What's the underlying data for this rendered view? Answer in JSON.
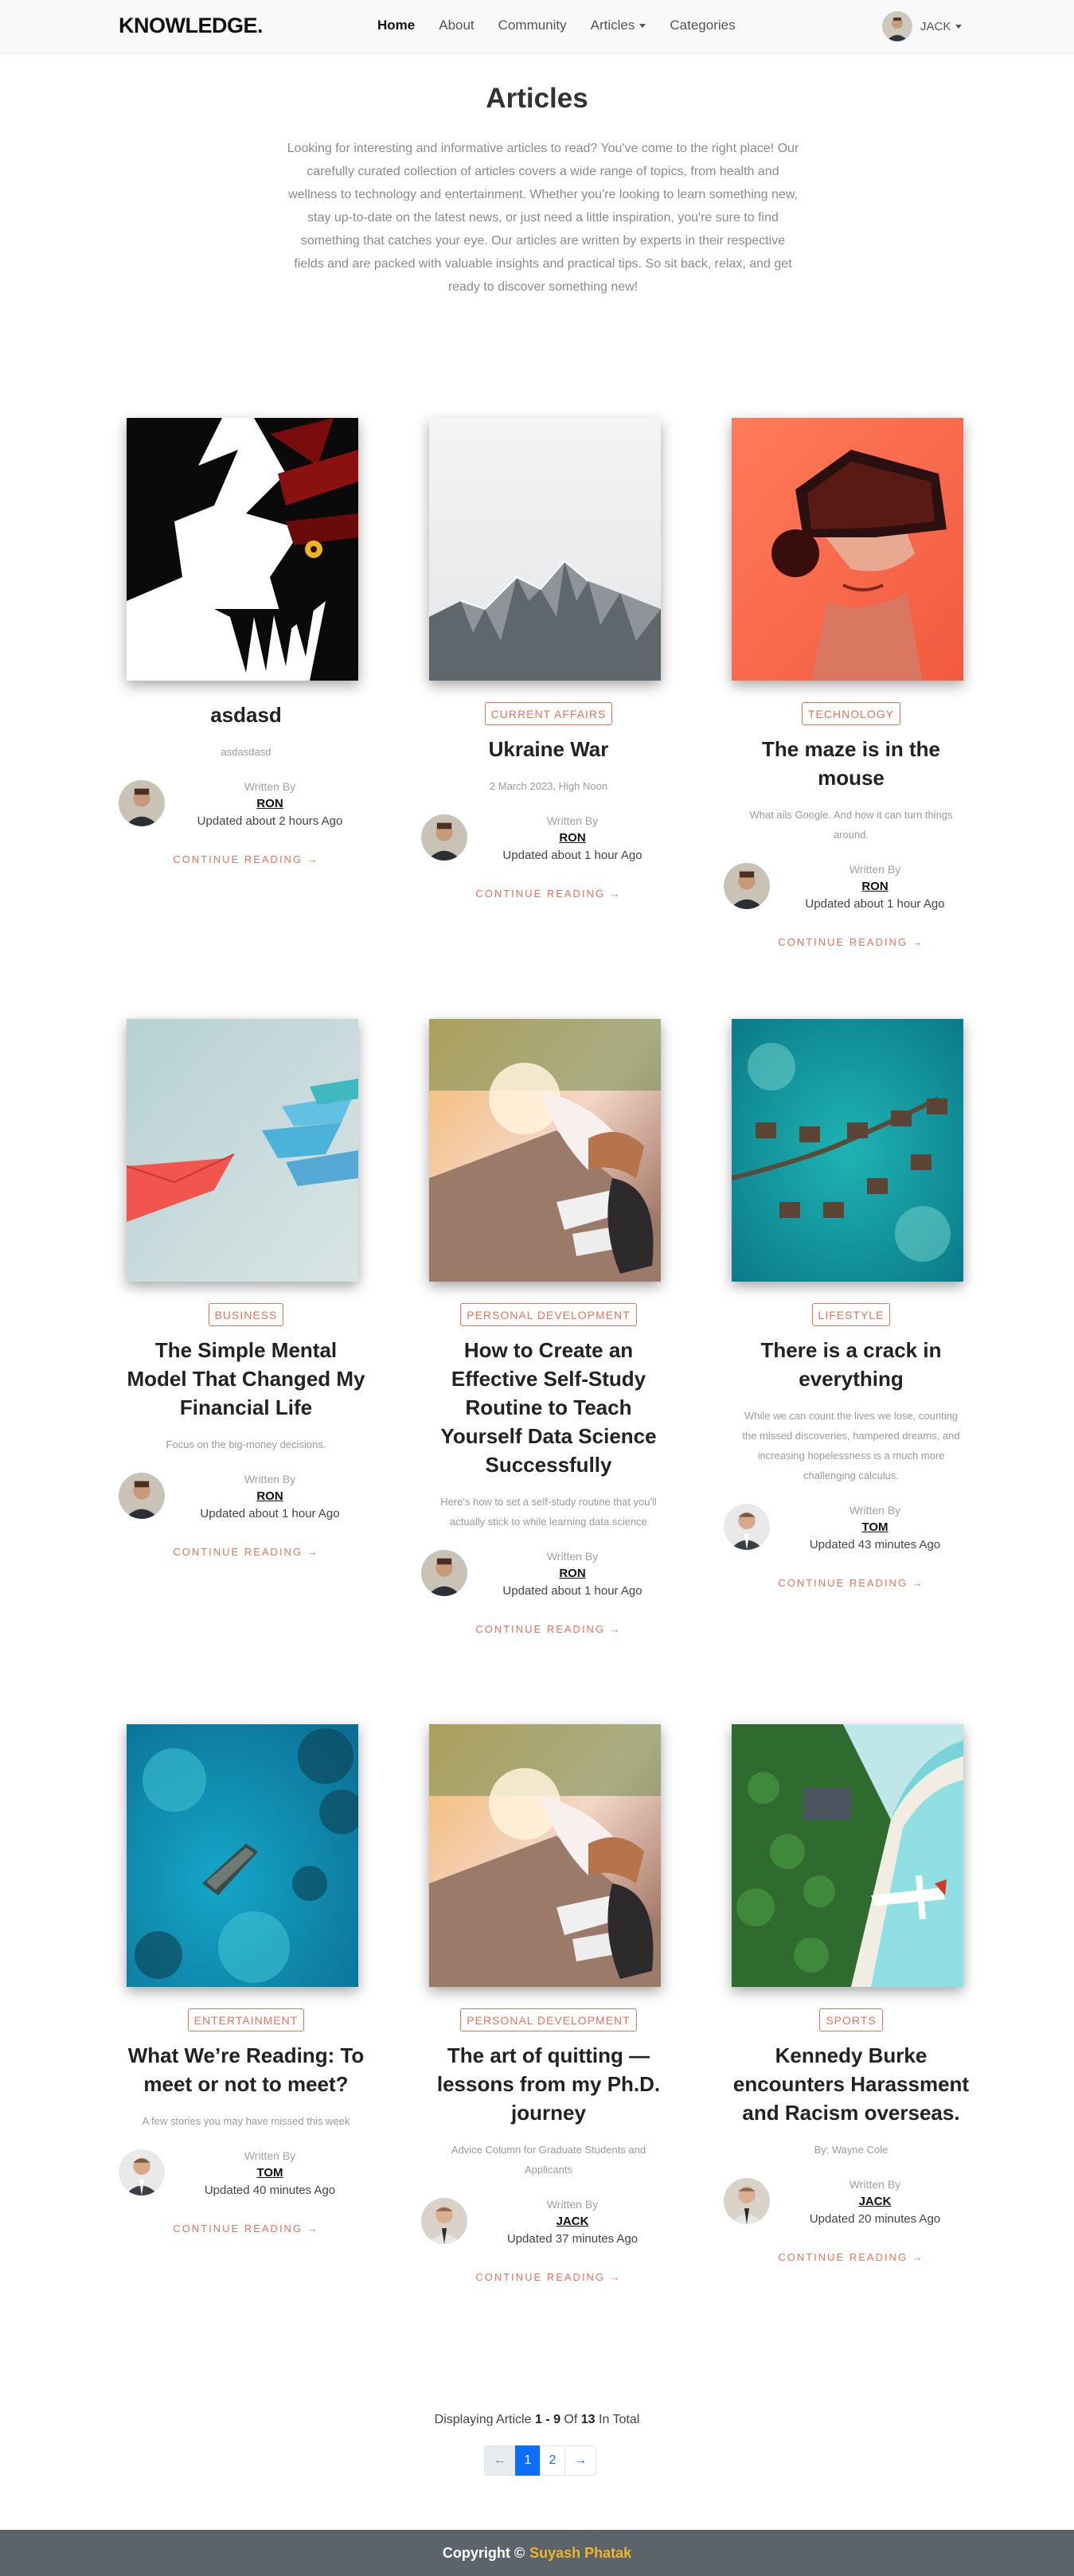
{
  "nav": {
    "brand": "KNOWLEDGE.",
    "links": [
      "Home",
      "About",
      "Community",
      "Articles",
      "Categories"
    ],
    "user_name": "JACK"
  },
  "header": {
    "title": "Articles",
    "intro": "Looking for interesting and informative articles to read? You've come to the right place! Our carefully curated collection of articles covers a wide range of topics, from health and wellness to technology and entertainment. Whether you're looking to learn something new, stay up-to-date on the latest news, or just need a little inspiration, you're sure to find something that catches your eye. Our articles are written by experts in their respective fields and are packed with valuable insights and practical tips. So sit back, relax, and get ready to discover something new!"
  },
  "byline_label": "Written By",
  "continue_label": "CONTINUE READING →",
  "articles": [
    {
      "image": "anime-mask-image",
      "tag": "",
      "title": "asdasd",
      "subtitle": "asdasdasd",
      "author": "RON",
      "updated": "Updated about 2 hours Ago"
    },
    {
      "image": "snowy-mountain-image",
      "tag": "CURRENT AFFAIRS",
      "title": "Ukraine War",
      "subtitle": "2 March 2023, High Noon",
      "author": "RON",
      "updated": "Updated about 1 hour Ago"
    },
    {
      "image": "vr-headset-image",
      "tag": "TECHNOLOGY",
      "title": "The maze is in the mouse",
      "subtitle": "What ails Google. And how it can turn things around.",
      "author": "RON",
      "updated": "Updated about 1 hour Ago"
    },
    {
      "image": "paper-boats-image",
      "tag": "BUSINESS",
      "title": "The Simple Mental Model That Changed My Financial Life",
      "subtitle": "Focus on the big-money decisions.",
      "author": "RON",
      "updated": "Updated about 1 hour Ago"
    },
    {
      "image": "sitting-person-image",
      "tag": "PERSONAL DEVELOPMENT",
      "title": "How to Create an Effective Self-Study Routine to Teach Yourself Data Science Successfully",
      "subtitle": "Here's how to set a self-study routine that you'll actually stick to while learning data science",
      "author": "RON",
      "updated": "Updated about 1 hour Ago"
    },
    {
      "image": "water-villas-image",
      "tag": "LIFESTYLE",
      "title": "There is a crack in everything",
      "subtitle": "While we can count the lives we lose, counting the missed discoveries, hampered dreams, and increasing hopelessness is a much more challenging calculus.",
      "author": "TOM",
      "updated": "Updated 43 minutes Ago"
    },
    {
      "image": "shipwreck-image",
      "tag": "ENTERTAINMENT",
      "title": "What We’re Reading: To meet or not to meet?",
      "subtitle": "A few stories you may have missed this week",
      "author": "TOM",
      "updated": "Updated 40 minutes Ago"
    },
    {
      "image": "sitting-person-image",
      "tag": "PERSONAL DEVELOPMENT",
      "title": "The art of quitting — lessons from my Ph.D. journey",
      "subtitle": "Advice Column for Graduate Students and Applicants",
      "author": "JACK",
      "updated": "Updated 37 minutes Ago"
    },
    {
      "image": "island-seaplane-image",
      "tag": "SPORTS",
      "title": "Kennedy Burke encounters Harassment and Racism overseas.",
      "subtitle": "By: Wayne Cole",
      "author": "JACK",
      "updated": "Updated 20 minutes Ago"
    }
  ],
  "pagination": {
    "prefix": "Displaying Article",
    "range": "1 - 9",
    "of": "Of",
    "total": "13",
    "suffix": "In Total",
    "prev": "←",
    "pages": [
      "1",
      "2"
    ],
    "next": "→"
  },
  "footer": {
    "copyright": "Copyright ©",
    "name": "Suyash Phatak"
  }
}
